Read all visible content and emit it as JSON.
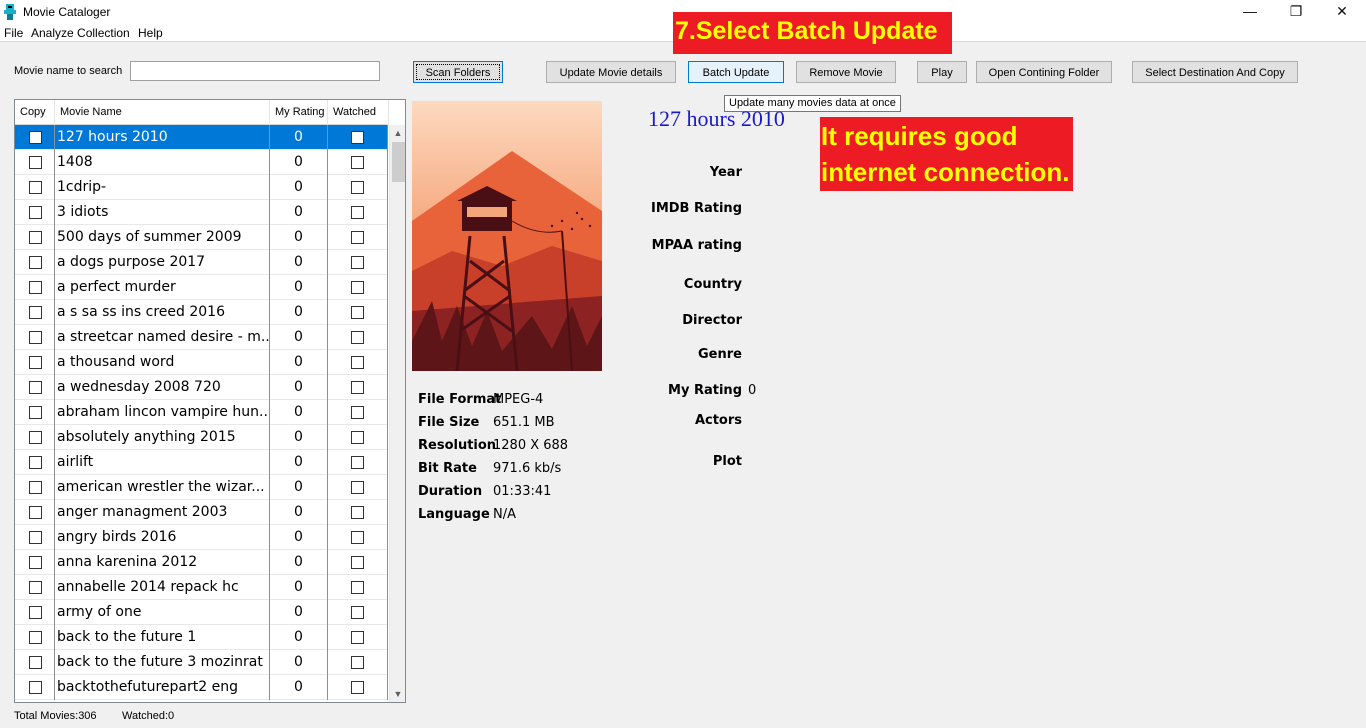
{
  "window": {
    "title": "Movie Cataloger",
    "minimize": "—",
    "restore": "❐",
    "close": "✕"
  },
  "menu": [
    "File",
    "Analyze Collection",
    "Help"
  ],
  "search": {
    "label": "Movie name to search",
    "value": ""
  },
  "toolbar": {
    "scan": "Scan Folders",
    "update_details": "Update Movie details",
    "batch_update": "Batch Update",
    "remove": "Remove Movie",
    "play": "Play",
    "open_folder": "Open Contining Folder",
    "select_copy": "Select Destination And Copy"
  },
  "tooltip": "Update many movies data at once",
  "annotations": {
    "step": "7.Select Batch Update",
    "note_line1": "It requires good",
    "note_line2": "internet connection."
  },
  "table": {
    "headers": {
      "copy": "Copy",
      "name": "Movie Name",
      "rating": "My Rating",
      "watched": "Watched"
    },
    "rows": [
      {
        "name": "127 hours 2010",
        "rating": "0",
        "selected": true
      },
      {
        "name": "1408",
        "rating": "0"
      },
      {
        "name": "1cdrip-",
        "rating": "0"
      },
      {
        "name": "3 idiots",
        "rating": "0"
      },
      {
        "name": "500 days of summer 2009",
        "rating": "0"
      },
      {
        "name": "a dogs purpose 2017",
        "rating": "0"
      },
      {
        "name": "a perfect murder",
        "rating": "0"
      },
      {
        "name": "a s sa ss ins creed 2016",
        "rating": "0"
      },
      {
        "name": "a streetcar named desire - m...",
        "rating": "0"
      },
      {
        "name": "a thousand word",
        "rating": "0"
      },
      {
        "name": "a wednesday 2008 720",
        "rating": "0"
      },
      {
        "name": "abraham lincon vampire hun...",
        "rating": "0"
      },
      {
        "name": "absolutely anything 2015",
        "rating": "0"
      },
      {
        "name": "airlift",
        "rating": "0"
      },
      {
        "name": "american wrestler the wizar...",
        "rating": "0"
      },
      {
        "name": "anger managment 2003",
        "rating": "0"
      },
      {
        "name": "angry birds 2016",
        "rating": "0"
      },
      {
        "name": "anna karenina 2012",
        "rating": "0"
      },
      {
        "name": "annabelle 2014 repack hc",
        "rating": "0"
      },
      {
        "name": "army of one",
        "rating": "0"
      },
      {
        "name": "back to the future 1",
        "rating": "0"
      },
      {
        "name": "back to the future 3 mozinrat",
        "rating": "0"
      },
      {
        "name": "backtothefuturepart2 eng",
        "rating": "0"
      }
    ]
  },
  "file_info": [
    {
      "label": "File Format",
      "value": "MPEG-4"
    },
    {
      "label": "File Size",
      "value": "651.1 MB"
    },
    {
      "label": "Resolution",
      "value": "1280 X 688"
    },
    {
      "label": "Bit Rate",
      "value": "971.6 kb/s"
    },
    {
      "label": "Duration",
      "value": "01:33:41"
    },
    {
      "label": "Language",
      "value": "N/A"
    }
  ],
  "details": {
    "title": "127 hours 2010",
    "year_label": "Year",
    "imdb_label": "IMDB Rating",
    "mpaa_label": "MPAA rating",
    "country_label": "Country",
    "director_label": "Director",
    "genre_label": "Genre",
    "my_rating_label": "My Rating",
    "my_rating_value": "0",
    "actors_label": "Actors",
    "plot_label": "Plot"
  },
  "status": {
    "total": "Total Movies:306",
    "watched": "Watched:0"
  },
  "colors": {
    "selection": "#0078d7",
    "annotation_bg": "#ed1c24",
    "annotation_text": "#ffff00",
    "title_blue": "#1a1acd"
  }
}
